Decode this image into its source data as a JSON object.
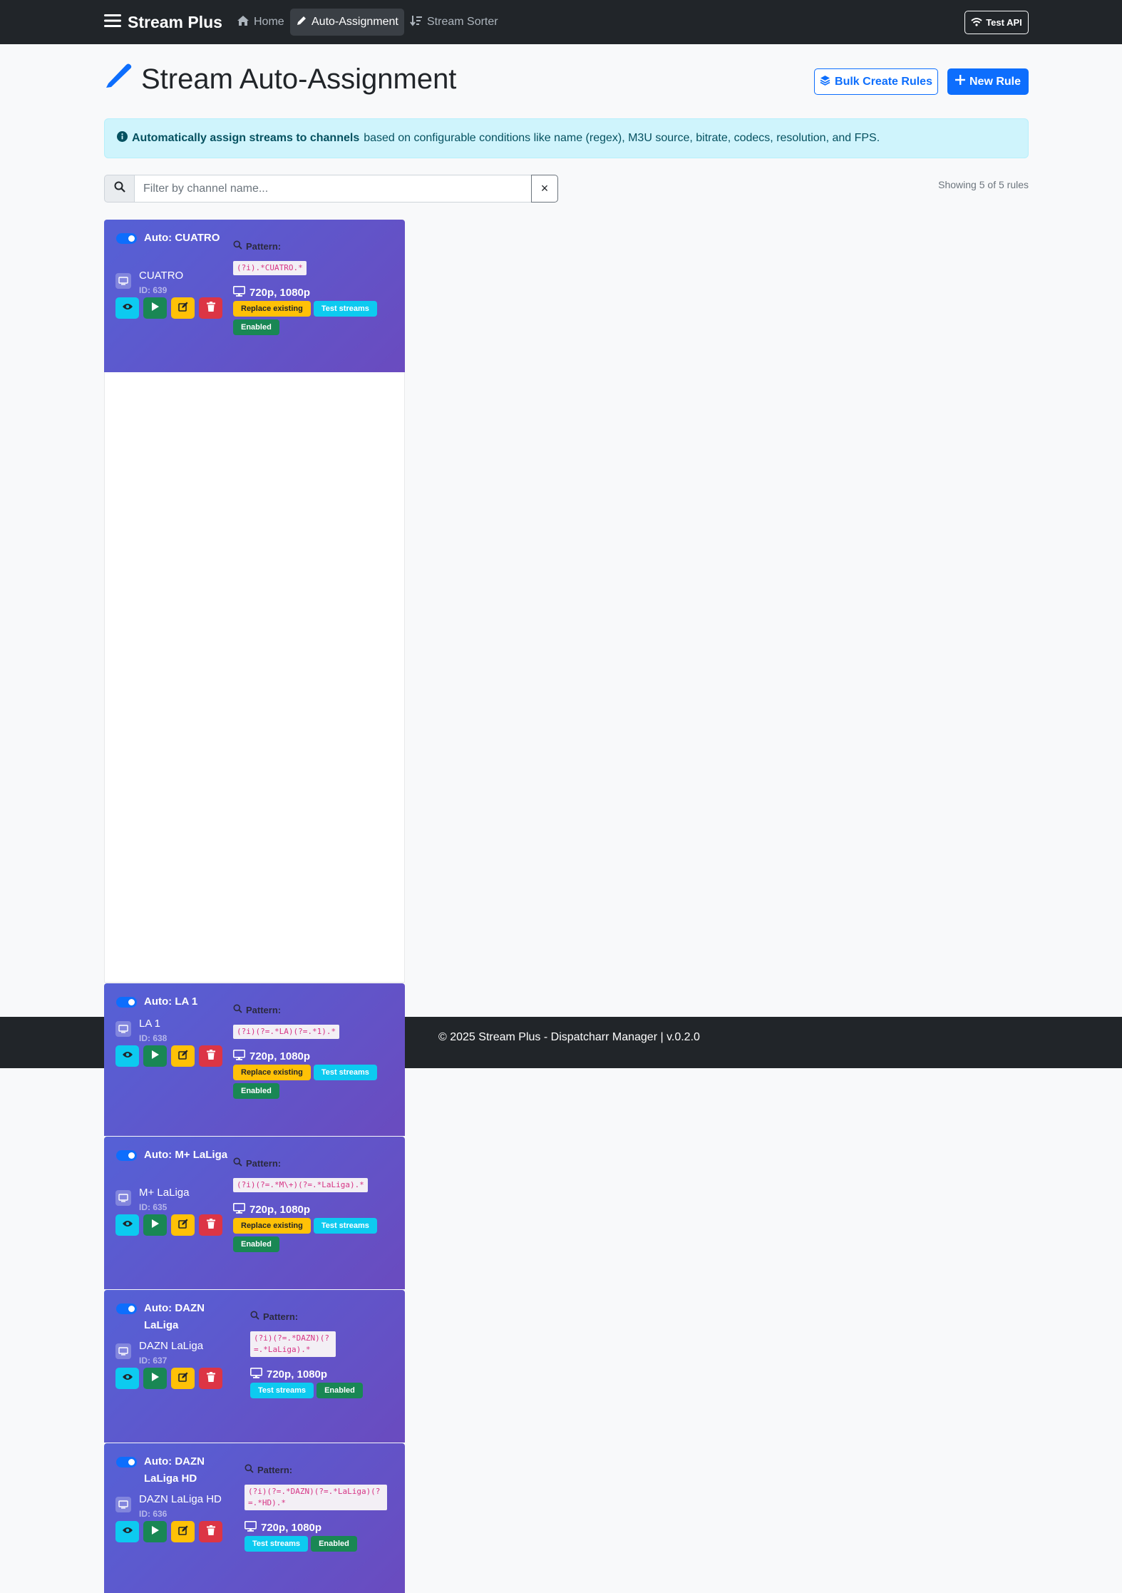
{
  "navbar": {
    "brand": "Stream Plus",
    "links": [
      {
        "label": "Home",
        "active": false
      },
      {
        "label": "Auto-Assignment",
        "active": true
      },
      {
        "label": "Stream Sorter",
        "active": false
      }
    ],
    "test_api": "Test API"
  },
  "header": {
    "title": "Stream Auto-Assignment",
    "bulk_button": "Bulk Create Rules",
    "new_button": "New Rule"
  },
  "alert": {
    "bold": "Automatically assign streams to channels",
    "text": "based on configurable conditions like name (regex), M3U source, bitrate, codecs, resolution, and FPS."
  },
  "search": {
    "placeholder": "Filter by channel name...",
    "clear": "×",
    "showing": "Showing 5 of 5 rules"
  },
  "cards": [
    {
      "title": "Auto: CUATRO",
      "channel": "CUATRO",
      "id": "ID: 639",
      "pattern_label": "Pattern:",
      "pattern": "(?i).*CUATRO.*",
      "resolution": "720p, 1080p",
      "badges": [
        "Replace existing",
        "Test streams",
        "Enabled"
      ],
      "enabled": true
    },
    {
      "title": "Auto: LA 1",
      "channel": "LA 1",
      "id": "ID: 638",
      "pattern_label": "Pattern:",
      "pattern": "(?i)(?=.*LA)(?=.*1).*",
      "resolution": "720p, 1080p",
      "badges": [
        "Replace existing",
        "Test streams",
        "Enabled"
      ],
      "enabled": true
    },
    {
      "title": "Auto: M+ LaLiga",
      "channel": "M+ LaLiga",
      "id": "ID: 635",
      "pattern_label": "Pattern:",
      "pattern": "(?i)(?=.*M\\+)(?=.*LaLiga).*",
      "resolution": "720p, 1080p",
      "badges": [
        "Replace existing",
        "Test streams",
        "Enabled"
      ],
      "enabled": true
    },
    {
      "title": "Auto: DAZN LaLiga",
      "channel": "DAZN LaLiga",
      "id": "ID: 637",
      "pattern_label": "Pattern:",
      "pattern": "(?i)(?=.*DAZN)(?=.*LaLiga).*",
      "resolution": "720p, 1080p",
      "badges": [
        "Test streams",
        "Enabled"
      ],
      "enabled": true
    },
    {
      "title": "Auto: DAZN LaLiga HD",
      "channel": "DAZN LaLiga HD",
      "id": "ID: 636",
      "pattern_label": "Pattern:",
      "pattern": "(?i)(?=.*DAZN)(?=.*LaLiga)(?=.*HD).*",
      "resolution": "720p, 1080p",
      "badges": [
        "Test streams",
        "Enabled"
      ],
      "enabled": true
    }
  ],
  "footer": {
    "text": "© 2025 Stream Plus - Dispatcharr Manager | v.0.2.0"
  },
  "colors": {
    "navbar": "#212529",
    "primary": "#0d6efd",
    "card_gradient_start": "#5561d6",
    "card_gradient_end": "#6a4bbf",
    "info_bg": "#cff4fc"
  }
}
